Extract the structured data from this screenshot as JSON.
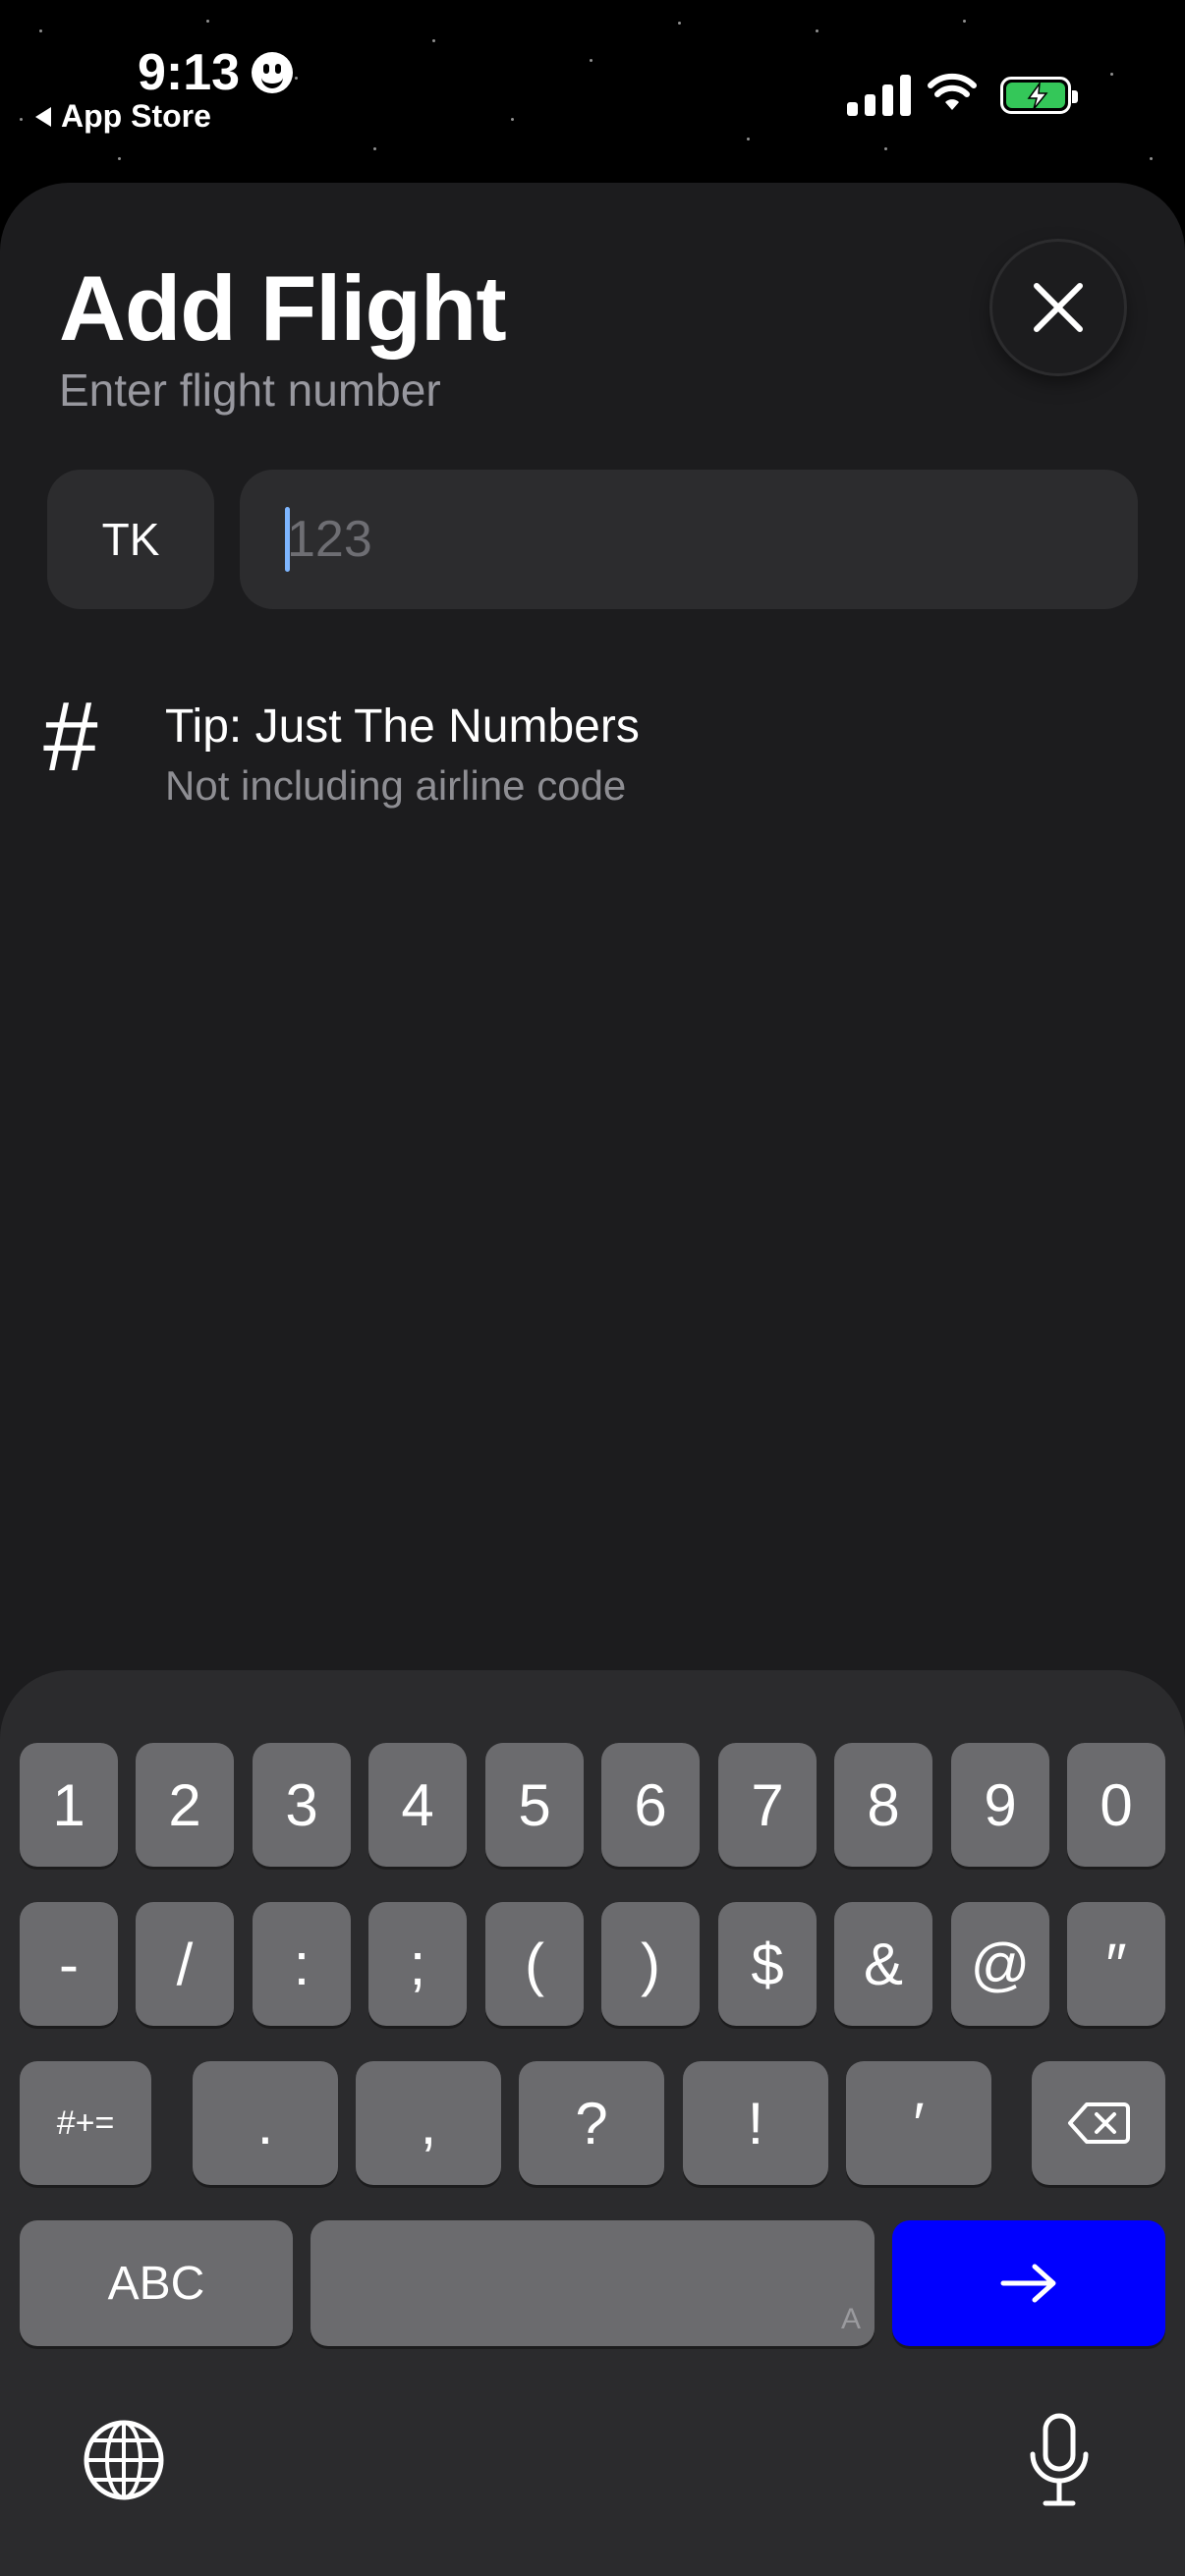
{
  "status_bar": {
    "time": "9:13",
    "back_app": "App Store"
  },
  "header": {
    "title": "Add Flight",
    "subtitle": "Enter flight number"
  },
  "flight_entry": {
    "airline_code": "TK",
    "number_placeholder": "123",
    "number_value": ""
  },
  "tip": {
    "icon": "#",
    "title": "Tip: Just The Numbers",
    "subtitle": "Not including airline code"
  },
  "keyboard": {
    "row1": [
      "1",
      "2",
      "3",
      "4",
      "5",
      "6",
      "7",
      "8",
      "9",
      "0"
    ],
    "row2": [
      "-",
      "/",
      ":",
      ";",
      "(",
      ")",
      "$",
      "&",
      "@",
      "″"
    ],
    "row3": [
      ".",
      ",",
      "?",
      "!",
      "′"
    ],
    "symbols_label": "#+=",
    "abc_label": "ABC",
    "space_mark": "A"
  },
  "colors": {
    "accent_go": "#0000ff",
    "background": "#1c1c1e",
    "battery": "#34c759"
  },
  "icons": [
    "close-icon",
    "delete-icon",
    "arrow-right-icon",
    "globe-icon",
    "microphone-icon",
    "wifi-icon",
    "signal-icon",
    "battery-icon"
  ]
}
